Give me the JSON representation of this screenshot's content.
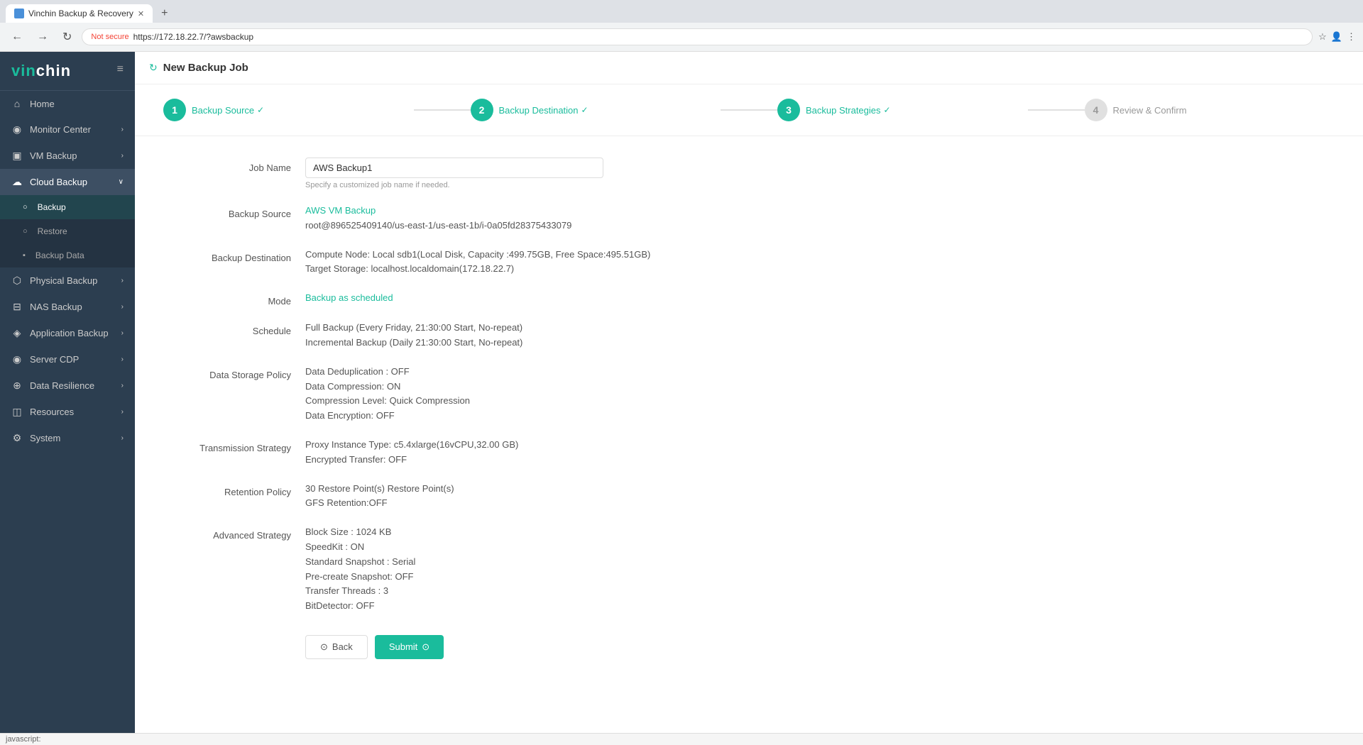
{
  "browser": {
    "tab_title": "Vinchin Backup & Recovery",
    "url": "https://172.18.22.7/?awsbackup",
    "not_secure_label": "Not secure"
  },
  "sidebar": {
    "logo": "vinchin",
    "items": [
      {
        "id": "home",
        "label": "Home",
        "icon": "⌂",
        "active": false
      },
      {
        "id": "monitor-center",
        "label": "Monitor Center",
        "icon": "◉",
        "active": false,
        "arrow": "›"
      },
      {
        "id": "vm-backup",
        "label": "VM Backup",
        "icon": "▣",
        "active": false,
        "arrow": "›"
      },
      {
        "id": "cloud-backup",
        "label": "Cloud Backup",
        "icon": "☁",
        "active": true,
        "arrow": "∨",
        "sub": [
          {
            "id": "backup",
            "label": "Backup",
            "active": true
          },
          {
            "id": "restore",
            "label": "Restore",
            "active": false
          },
          {
            "id": "backup-data",
            "label": "Backup Data",
            "active": false
          }
        ]
      },
      {
        "id": "physical-backup",
        "label": "Physical Backup",
        "icon": "⬡",
        "active": false,
        "arrow": "›"
      },
      {
        "id": "nas-backup",
        "label": "NAS Backup",
        "icon": "⊟",
        "active": false,
        "arrow": "›"
      },
      {
        "id": "application-backup",
        "label": "Application Backup",
        "icon": "◈",
        "active": false,
        "arrow": "›"
      },
      {
        "id": "server-cdp",
        "label": "Server CDP",
        "icon": "◉",
        "active": false,
        "arrow": "›"
      },
      {
        "id": "data-resilience",
        "label": "Data Resilience",
        "icon": "⊕",
        "active": false,
        "arrow": "›"
      },
      {
        "id": "resources",
        "label": "Resources",
        "icon": "◫",
        "active": false,
        "arrow": "›"
      },
      {
        "id": "system",
        "label": "System",
        "icon": "⚙",
        "active": false,
        "arrow": "›"
      }
    ]
  },
  "header": {
    "title": "New Backup Job",
    "refresh_icon": "↻"
  },
  "stepper": {
    "steps": [
      {
        "num": "1",
        "label": "Backup Source",
        "state": "done"
      },
      {
        "num": "2",
        "label": "Backup Destination",
        "state": "done"
      },
      {
        "num": "3",
        "label": "Backup Strategies",
        "state": "done"
      },
      {
        "num": "4",
        "label": "Review & Confirm",
        "state": "inactive"
      }
    ]
  },
  "form": {
    "job_name": {
      "label": "Job Name",
      "value": "AWS Backup1",
      "hint": "Specify a customized job name if needed."
    },
    "backup_source": {
      "label": "Backup Source",
      "line1": "AWS VM Backup",
      "line2": "root@896525409140/us-east-1/us-east-1b/i-0a05fd28375433079"
    },
    "backup_destination": {
      "label": "Backup Destination",
      "line1": "Compute Node: Local sdb1(Local Disk, Capacity :499.75GB, Free Space:495.51GB)",
      "line2": "Target Storage: localhost.localdomain(172.18.22.7)"
    },
    "mode": {
      "label": "Mode",
      "value": "Backup as scheduled"
    },
    "schedule": {
      "label": "Schedule",
      "line1": "Full Backup (Every Friday, 21:30:00 Start, No-repeat)",
      "line2": "Incremental Backup (Daily 21:30:00 Start, No-repeat)"
    },
    "data_storage_policy": {
      "label": "Data Storage Policy",
      "line1": "Data Deduplication : OFF",
      "line2": "Data Compression: ON",
      "line3": "Compression Level: Quick Compression",
      "line4": "Data Encryption: OFF"
    },
    "transmission_strategy": {
      "label": "Transmission Strategy",
      "line1": "Proxy Instance Type: c5.4xlarge(16vCPU,32.00 GB)",
      "line2": "Encrypted Transfer: OFF"
    },
    "retention_policy": {
      "label": "Retention Policy",
      "line1": "30 Restore Point(s) Restore Point(s)",
      "line2": "GFS Retention:OFF"
    },
    "advanced_strategy": {
      "label": "Advanced Strategy",
      "line1": "Block Size : 1024 KB",
      "line2": "SpeedKit : ON",
      "line3": "Standard Snapshot : Serial",
      "line4": "Pre-create Snapshot: OFF",
      "line5": "Transfer Threads : 3",
      "line6": "BitDetector: OFF"
    }
  },
  "buttons": {
    "back": "Back",
    "submit": "Submit"
  },
  "status_bar": {
    "text": "javascript:"
  }
}
